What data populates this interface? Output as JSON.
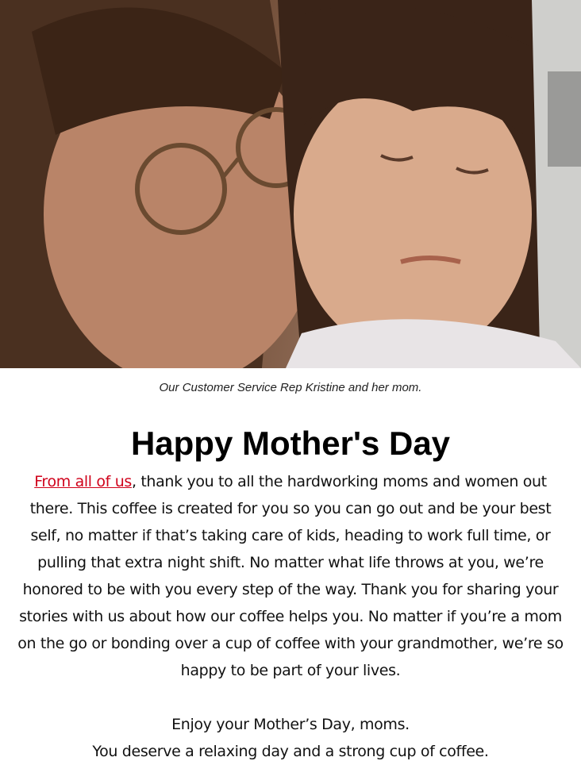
{
  "hero": {
    "caption": "Our Customer Service Rep Kristine and her mom."
  },
  "article": {
    "headline": "Happy Mother's Day",
    "link_text": "From all of us",
    "body_text": ", thank you to all the hardworking moms and women out there. This coffee is created for you so you can go out and be your best self, no matter if that’s taking care of kids, heading to work full time, or pulling that extra night shift. No matter what life throws at you, we’re honored to be with you every step of the way. Thank you for sharing your stories with us about how our coffee helps you. No matter if you’re a mom on the go or bonding over a cup of coffee with your grandmother, we’re so happy to be part of your lives.",
    "closing_line1": "Enjoy your Mother’s Day, moms.",
    "closing_line2": "You deserve a relaxing day and a strong cup of coffee."
  },
  "colors": {
    "link": "#d0021b",
    "background": "#ffffff"
  }
}
